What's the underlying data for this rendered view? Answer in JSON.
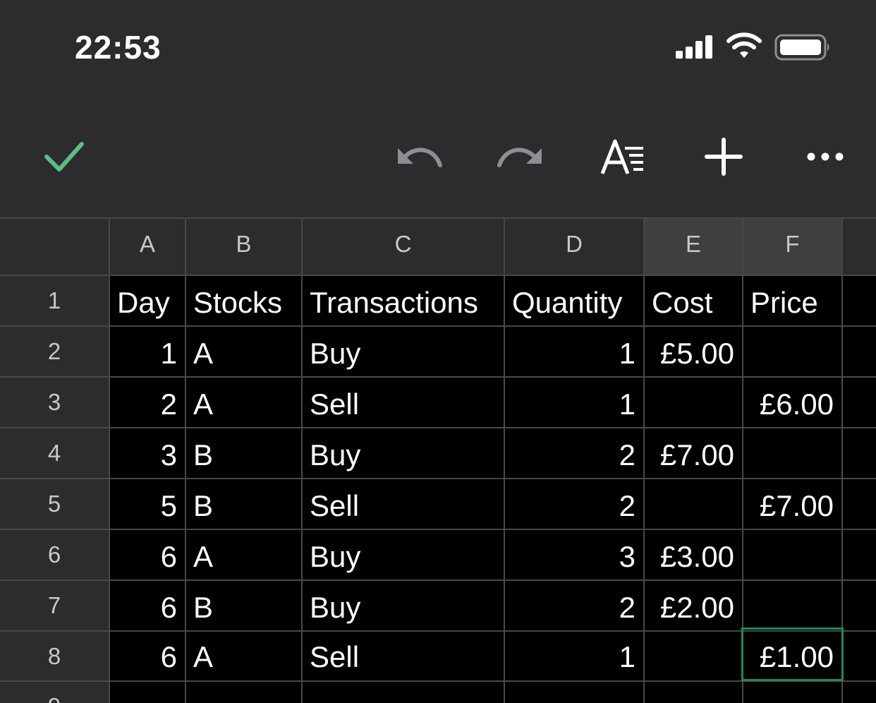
{
  "status_bar": {
    "time": "22:53"
  },
  "toolbar": {
    "icons": [
      "check-icon",
      "undo-icon",
      "redo-icon",
      "text-format-icon",
      "plus-icon",
      "more-icon"
    ],
    "accent_color": "#5bbf84"
  },
  "sheet": {
    "column_headers": [
      "A",
      "B",
      "C",
      "D",
      "E",
      "F"
    ],
    "row_numbers": [
      "1",
      "2",
      "3",
      "4",
      "5",
      "6",
      "7",
      "8",
      "9"
    ],
    "header_row": [
      "Day",
      "Stocks",
      "Transactions",
      "Quantity",
      "Cost",
      "Price"
    ],
    "rows": [
      [
        "1",
        "A",
        "Buy",
        "1",
        "£5.00",
        ""
      ],
      [
        "2",
        "A",
        "Sell",
        "1",
        "",
        "£6.00"
      ],
      [
        "3",
        "B",
        "Buy",
        "2",
        "£7.00",
        ""
      ],
      [
        "5",
        "B",
        "Sell",
        "2",
        "",
        "£7.00"
      ],
      [
        "6",
        "A",
        "Buy",
        "3",
        "£3.00",
        ""
      ],
      [
        "6",
        "B",
        "Buy",
        "2",
        "£2.00",
        ""
      ],
      [
        "6",
        "A",
        "Sell",
        "1",
        "",
        "£1.00"
      ]
    ],
    "selected_cell": "F8",
    "selection_color": "#1f8c55"
  }
}
